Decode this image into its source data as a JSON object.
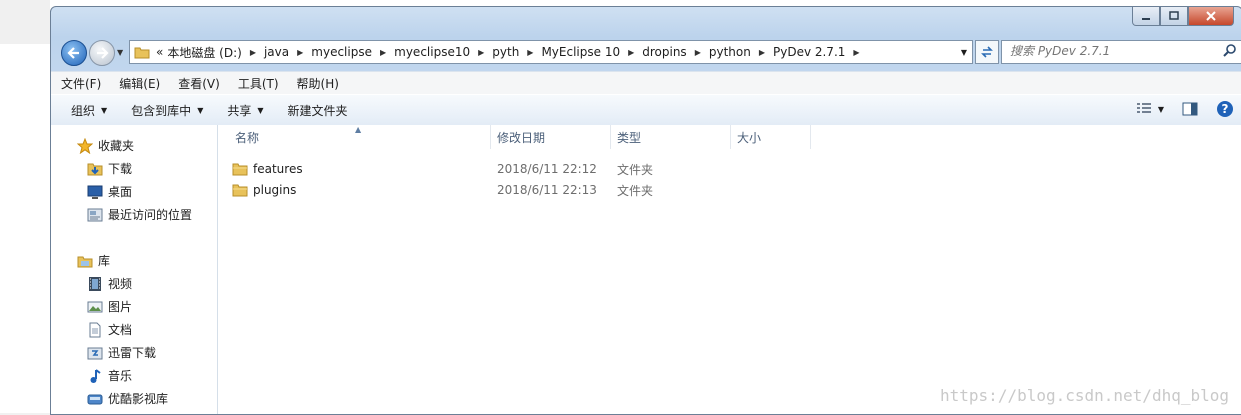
{
  "window": {
    "caption_buttons": [
      "minimize",
      "maximize",
      "close"
    ]
  },
  "navigation": {
    "address_prefix": "«",
    "breadcrumbs": [
      "本地磁盘 (D:)",
      "java",
      "myeclipse",
      "myeclipse10",
      "pyth",
      "MyEclipse 10",
      "dropins",
      "python",
      "PyDev 2.7.1"
    ],
    "search_placeholder": "搜索 PyDev 2.7.1"
  },
  "menubar": {
    "items": [
      "文件(F)",
      "编辑(E)",
      "查看(V)",
      "工具(T)",
      "帮助(H)"
    ]
  },
  "toolbar": {
    "organize": "组织",
    "include_library": "包含到库中",
    "share": "共享",
    "new_folder": "新建文件夹"
  },
  "sidebar": {
    "favorites_header": "收藏夹",
    "favorites": [
      {
        "label": "下载",
        "icon": "download-folder-icon"
      },
      {
        "label": "桌面",
        "icon": "desktop-icon"
      },
      {
        "label": "最近访问的位置",
        "icon": "recent-places-icon"
      }
    ],
    "libraries_header": "库",
    "libraries": [
      {
        "label": "视频",
        "icon": "video-icon"
      },
      {
        "label": "图片",
        "icon": "picture-icon"
      },
      {
        "label": "文档",
        "icon": "document-icon"
      },
      {
        "label": "迅雷下载",
        "icon": "thunder-download-icon"
      },
      {
        "label": "音乐",
        "icon": "music-icon"
      },
      {
        "label": "优酷影视库",
        "icon": "youku-library-icon"
      }
    ]
  },
  "file_list": {
    "columns": [
      "名称",
      "修改日期",
      "类型",
      "大小"
    ],
    "rows": [
      {
        "name": "features",
        "date": "2018/6/11 22:12",
        "type": "文件夹",
        "size": ""
      },
      {
        "name": "plugins",
        "date": "2018/6/11 22:13",
        "type": "文件夹",
        "size": ""
      }
    ]
  },
  "watermark": "https://blog.csdn.net/dhq_blog",
  "colors": {
    "titlebar": "#bcd3ec",
    "close_button": "#c6472b",
    "folder": "#e8c25a",
    "accent_blue": "#1f62b8"
  }
}
